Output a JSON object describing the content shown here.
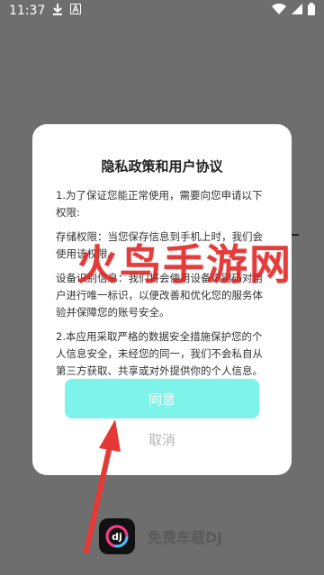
{
  "status_bar": {
    "time": "11:37",
    "icons": [
      "download-icon",
      "notification-a-icon",
      "wifi-icon",
      "signal-icon",
      "battery-icon"
    ]
  },
  "dialog": {
    "title": "隐私政策和用户协议",
    "paragraphs": [
      "1.为了保证您能正常使用，需要向您申请以下权限:",
      "存储权限：当您保存信息到手机上时，我们会使用该权限。",
      "设备识别信息：我们将会使用设备识别码对用户进行唯一标识，以便改善和优化您的服务体验并保障您的账号安全。",
      "2.本应用采取严格的数据安全措施保护您的个人信息安全，未经您的同一，我们不会私自从第三方获取、共享或对外提供你的个人信息。"
    ],
    "agree_label": "同意",
    "cancel_label": "取消"
  },
  "watermark": "火鸟手游网",
  "background_app": {
    "name": "免费车载DJ",
    "icon": "dj-app-icon"
  },
  "colors": {
    "overlay": "#6e6e6e",
    "agree_button": "#7ef3ea",
    "cancel_text": "#b5b5b5",
    "arrow": "#e53935"
  }
}
